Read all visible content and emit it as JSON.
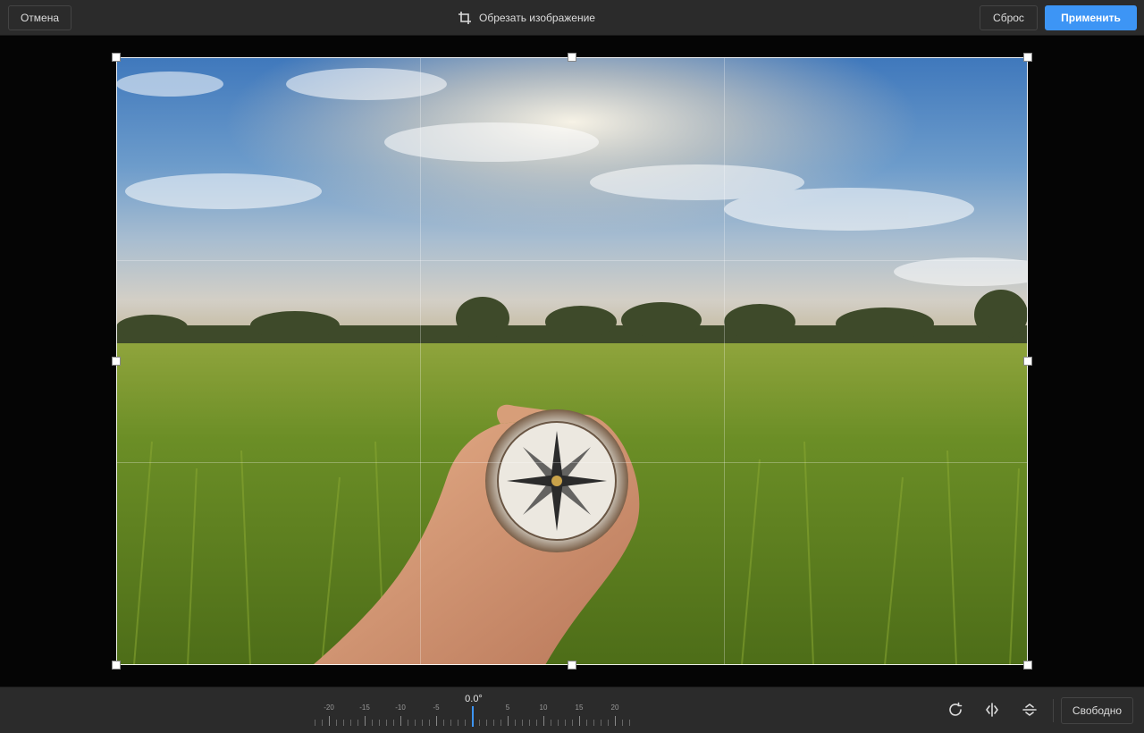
{
  "toolbar": {
    "cancel_label": "Отмена",
    "title": "Обрезать изображение",
    "title_icon": "crop-icon",
    "reset_label": "Сброс",
    "apply_label": "Применить"
  },
  "colors": {
    "accent": "#3d95f5",
    "bar_background": "#2b2b2b",
    "canvas_background": "#050505"
  },
  "photo": {
    "subject": "hand holding a compass over a green rice field under a sunny sky"
  },
  "rotation": {
    "value_label": "0.0°",
    "value": 0,
    "tick_labels": [
      "-20",
      "-15",
      "-10",
      "-5",
      "5",
      "10",
      "15",
      "20"
    ]
  },
  "tools": {
    "rotate_icon": "rotate-clockwise-icon",
    "flip_horizontal_icon": "flip-horizontal-icon",
    "flip_vertical_icon": "flip-vertical-icon",
    "aspect_label": "Свободно"
  }
}
